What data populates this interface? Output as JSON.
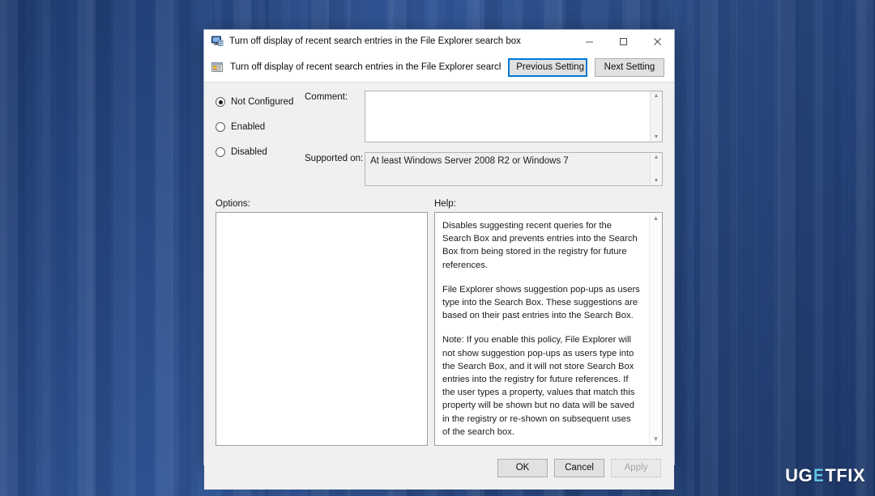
{
  "desktop": {
    "background_color": "#2f5496",
    "watermark": {
      "part1": "UG",
      "part2": "E",
      "part3": "TFIX",
      "accent_color": "#5fc6e8"
    }
  },
  "dialog": {
    "titlebar": {
      "icon": "monitor-policy-icon",
      "title": "Turn off display of recent search entries in the File Explorer search box",
      "minimize_glyph": "—",
      "maximize_glyph": "☐",
      "close_glyph": "✕"
    },
    "header": {
      "icon": "policy-setting-icon",
      "title": "Turn off display of recent search entries in the File Explorer search box",
      "previous_button": "Previous Setting",
      "next_button": "Next Setting",
      "focused_button": "Previous Setting",
      "focus_color": "#0078d7"
    },
    "state_options": [
      {
        "label": "Not Configured",
        "selected": true
      },
      {
        "label": "Enabled",
        "selected": false
      },
      {
        "label": "Disabled",
        "selected": false
      }
    ],
    "comment": {
      "label": "Comment:",
      "value": "",
      "placeholder": ""
    },
    "supported_on": {
      "label": "Supported on:",
      "value": "At least Windows Server 2008 R2 or Windows 7"
    },
    "options_panel": {
      "label": "Options:",
      "content": ""
    },
    "help_panel": {
      "label": "Help:",
      "paragraphs": [
        "Disables suggesting recent queries for the Search Box and prevents entries into the Search Box from being stored in the registry for future references.",
        "File Explorer shows suggestion pop-ups as users type into the Search Box.  These suggestions are based on their past entries into the Search Box.",
        "Note: If you enable this policy, File Explorer will not show suggestion pop-ups as users type into the Search Box, and it will not store Search Box entries into the registry for future references.  If the user types a property, values that match this property will be shown but no data will be saved in the registry or re-shown on subsequent uses of the search box."
      ]
    },
    "footer": {
      "ok": "OK",
      "cancel": "Cancel",
      "apply": "Apply",
      "apply_disabled": true
    },
    "scroll_arrows": {
      "up": "▲",
      "down": "▼"
    }
  }
}
